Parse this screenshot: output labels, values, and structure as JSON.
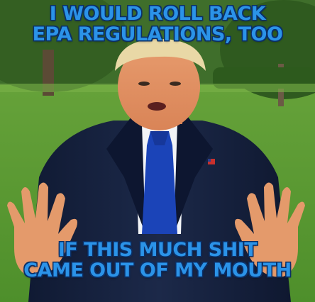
{
  "meme": {
    "top_lines": [
      "I WOULD ROLL BACK",
      "EPA REGULATIONS, TOO"
    ],
    "bottom_lines": [
      "IF THIS MUCH SHIT",
      "CAME OUT OF MY MOUTH"
    ],
    "caption_color": "#2b93e8",
    "outline_color": "#0b2f66"
  }
}
